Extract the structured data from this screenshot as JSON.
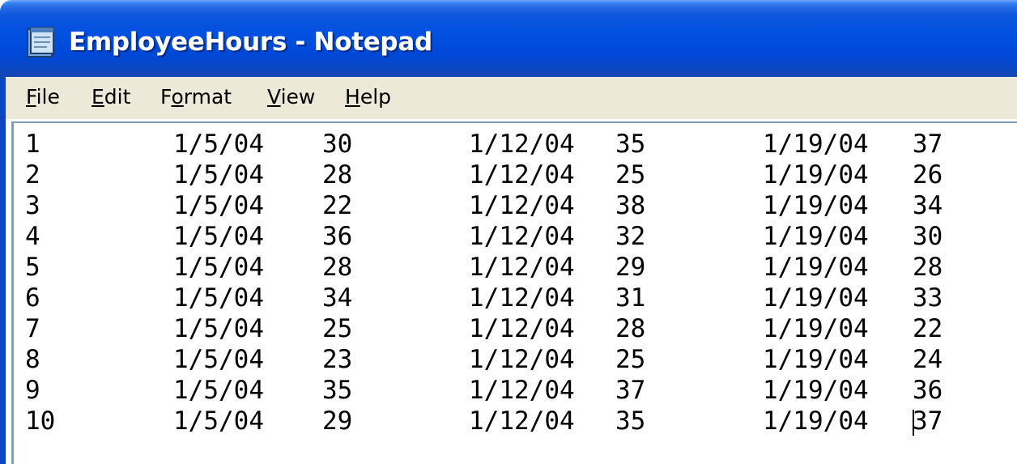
{
  "window": {
    "title": "EmployeeHours - Notepad"
  },
  "menu": {
    "items": [
      {
        "label_accel": "F",
        "label_rest": "ile"
      },
      {
        "label_accel": "E",
        "label_rest": "dit"
      },
      {
        "label_pre": "F",
        "label_accel": "o",
        "label_rest": "rmat"
      },
      {
        "label_accel": "V",
        "label_rest": "iew"
      },
      {
        "label_accel": "H",
        "label_rest": "elp"
      }
    ]
  },
  "document": {
    "rows": [
      {
        "id": "1",
        "d1": "1/5/04",
        "h1": "30",
        "d2": "1/12/04",
        "h2": "35",
        "d3": "1/19/04",
        "h3": "37"
      },
      {
        "id": "2",
        "d1": "1/5/04",
        "h1": "28",
        "d2": "1/12/04",
        "h2": "25",
        "d3": "1/19/04",
        "h3": "26"
      },
      {
        "id": "3",
        "d1": "1/5/04",
        "h1": "22",
        "d2": "1/12/04",
        "h2": "38",
        "d3": "1/19/04",
        "h3": "34"
      },
      {
        "id": "4",
        "d1": "1/5/04",
        "h1": "36",
        "d2": "1/12/04",
        "h2": "32",
        "d3": "1/19/04",
        "h3": "30"
      },
      {
        "id": "5",
        "d1": "1/5/04",
        "h1": "28",
        "d2": "1/12/04",
        "h2": "29",
        "d3": "1/19/04",
        "h3": "28"
      },
      {
        "id": "6",
        "d1": "1/5/04",
        "h1": "34",
        "d2": "1/12/04",
        "h2": "31",
        "d3": "1/19/04",
        "h3": "33"
      },
      {
        "id": "7",
        "d1": "1/5/04",
        "h1": "25",
        "d2": "1/12/04",
        "h2": "28",
        "d3": "1/19/04",
        "h3": "22"
      },
      {
        "id": "8",
        "d1": "1/5/04",
        "h1": "23",
        "d2": "1/12/04",
        "h2": "25",
        "d3": "1/19/04",
        "h3": "24"
      },
      {
        "id": "9",
        "d1": "1/5/04",
        "h1": "35",
        "d2": "1/12/04",
        "h2": "37",
        "d3": "1/19/04",
        "h3": "36"
      },
      {
        "id": "10",
        "d1": "1/5/04",
        "h1": "29",
        "d2": "1/12/04",
        "h2": "35",
        "d3": "1/19/04",
        "h3": "37"
      }
    ]
  },
  "colors": {
    "titlebar": "#0150e0",
    "menubar": "#ece9d8",
    "text": "#000000"
  },
  "icons": {
    "app": "notepad-icon"
  }
}
